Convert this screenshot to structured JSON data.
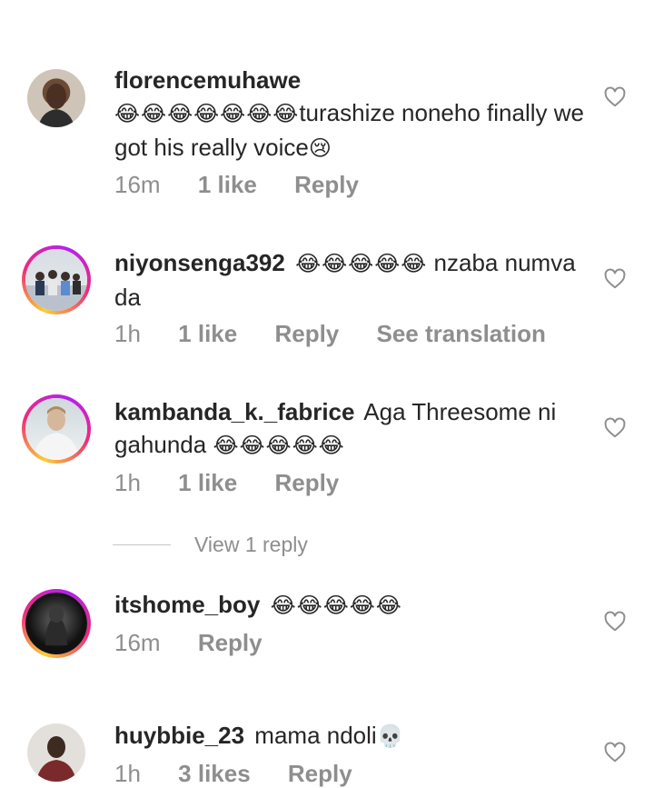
{
  "comments": [
    {
      "username": "florencemuhawe",
      "emojis": "😂😂😂😂😂😂😂",
      "text": "turashize noneho finally we got his really voice",
      "trailing_emoji": "😢",
      "time": "16m",
      "likes": "1 like",
      "reply": "Reply"
    },
    {
      "username": "niyonsenga392",
      "emojis": "😂😂😂😂😂",
      "text": "nzaba numva da",
      "time": "1h",
      "likes": "1 like",
      "reply": "Reply",
      "translation": "See translation"
    },
    {
      "username": "kambanda_k._fabrice",
      "text": "Aga Threesome ni gahunda",
      "emojis": "😂😂😂😂😂",
      "time": "1h",
      "likes": "1 like",
      "reply": "Reply",
      "view_replies": "View 1 reply"
    },
    {
      "username": "itshome_boy",
      "emojis": "😂😂😂😂😂",
      "time": "16m",
      "reply": "Reply"
    },
    {
      "username": "huybbie_23",
      "text": "mama ndoli",
      "emojis": "💀",
      "time": "1h",
      "likes": "3 likes",
      "reply": "Reply"
    }
  ],
  "icons": {
    "like": "heart-outline-icon"
  },
  "colors": {
    "text": "#262626",
    "secondary": "#8e8e8e",
    "story_ring": [
      "#f9ce34",
      "#ee2a7b",
      "#b41ff3"
    ]
  }
}
